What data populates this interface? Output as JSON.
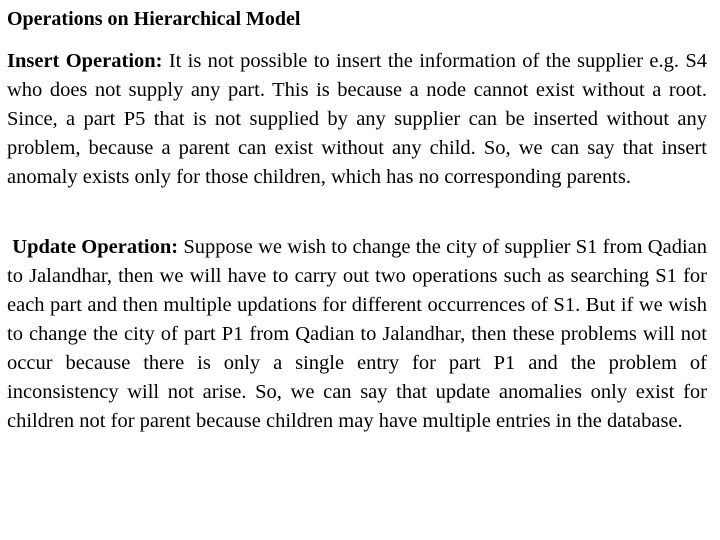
{
  "title": "Operations on Hierarchical Model",
  "sections": [
    {
      "heading": "Insert Operation:",
      "body": "It is not possible to insert the information of the supplier e.g. S4 who does not supply any part. This is because a node cannot exist without a root. Since, a part P5 that is not supplied by any supplier can be inserted without any problem, because a parent can exist without any child. So, we can say that insert anomaly exists only for those children, which has no corresponding parents."
    },
    {
      "heading": "Update Operation:",
      "body": "Suppose we wish to change the city of supplier S1 from Qadian to Jalandhar, then we will have to carry out two operations such as searching S1 for each part and then multiple updations for different occurrences of S1. But if we wish to change the city of part P1 from Qadian to Jalandhar, then these problems will not occur because there is only a single entry for part P1 and the problem of inconsistency will not arise. So, we can say that update anomalies only exist for children not for parent because children may have multiple entries in the database."
    }
  ]
}
